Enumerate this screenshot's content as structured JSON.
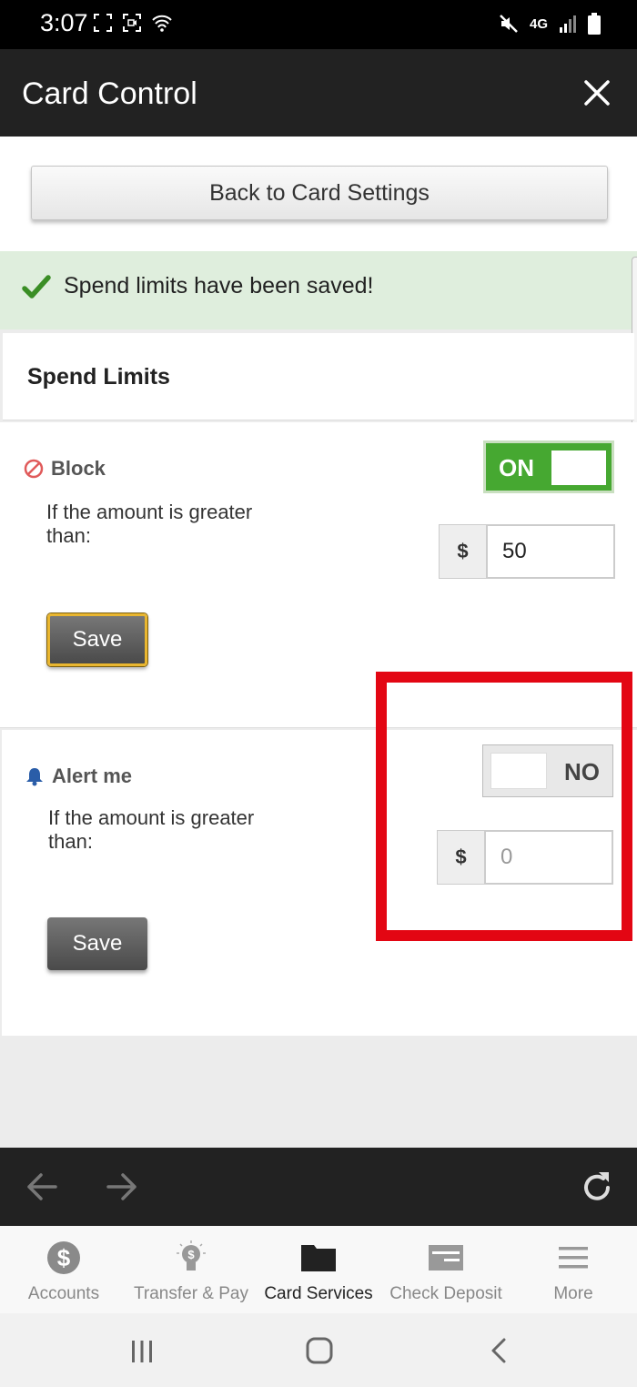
{
  "status_bar": {
    "time": "3:07",
    "network": "4G"
  },
  "header": {
    "title": "Card Control"
  },
  "back_button": {
    "label": "Back to Card Settings"
  },
  "banner": {
    "message": "Spend limits have been saved!"
  },
  "section": {
    "title": "Spend Limits"
  },
  "block": {
    "label": "Block",
    "description": "If the amount is greater than:",
    "toggle_label": "ON",
    "toggle_state": true,
    "currency": "$",
    "amount": "50",
    "save_label": "Save"
  },
  "alert": {
    "label": "Alert me",
    "description": "If the amount is greater than:",
    "toggle_label": "NO",
    "toggle_state": false,
    "currency": "$",
    "amount_placeholder": "0",
    "save_label": "Save"
  },
  "bottom_nav": {
    "items": [
      {
        "label": "Accounts",
        "icon": "dollar-circle-icon"
      },
      {
        "label": "Transfer & Pay",
        "icon": "lightbulb-dollar-icon"
      },
      {
        "label": "Card Services",
        "icon": "folder-icon",
        "active": true
      },
      {
        "label": "Check Deposit",
        "icon": "check-icon"
      },
      {
        "label": "More",
        "icon": "hamburger-icon"
      }
    ]
  },
  "colors": {
    "header_bg": "#222222",
    "toggle_on": "#46a831",
    "success_bg": "#dfeedd",
    "highlight": "#e30613",
    "focus_border": "#e9b630"
  }
}
